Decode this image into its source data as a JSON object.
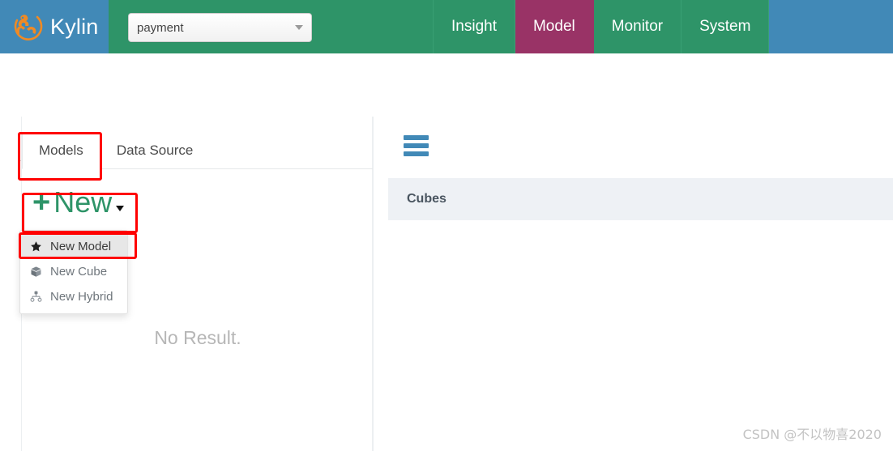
{
  "brand": {
    "name": "Kylin",
    "logo_icon": "kylin-creature-logo"
  },
  "topnav": {
    "project_select": {
      "value": "payment",
      "caret_icon": "caret-down-icon"
    },
    "items": [
      {
        "label": "Insight",
        "active": false
      },
      {
        "label": "Model",
        "active": true
      },
      {
        "label": "Monitor",
        "active": false
      },
      {
        "label": "System",
        "active": false
      }
    ],
    "colors": {
      "brand_bg": "#4189b7",
      "nav_bg": "#2e9468",
      "active_bg": "#993366"
    }
  },
  "toolbar": {
    "buttons": [
      {
        "name": "config-button",
        "icon": "gears-icon",
        "color": "#22bbe6"
      },
      {
        "name": "add-button",
        "icon": "plus-icon",
        "color": "#4189b7"
      }
    ]
  },
  "left_panel": {
    "tabs": [
      {
        "label": "Models",
        "active": true
      },
      {
        "label": "Data Source",
        "active": false
      }
    ],
    "new_button": {
      "plus": "+",
      "label": "New",
      "caret_icon": "caret-down-icon"
    },
    "dropdown": {
      "items": [
        {
          "label": "New Model",
          "icon": "star-icon",
          "active": true
        },
        {
          "label": "New Cube",
          "icon": "cube-icon",
          "active": false
        },
        {
          "label": "New Hybrid",
          "icon": "sitemap-icon",
          "active": false
        }
      ]
    },
    "empty_state": "No Result."
  },
  "right_panel": {
    "menu_icon": "hamburger-icon",
    "section_title": "Cubes"
  },
  "watermark": "CSDN @不以物喜2020"
}
